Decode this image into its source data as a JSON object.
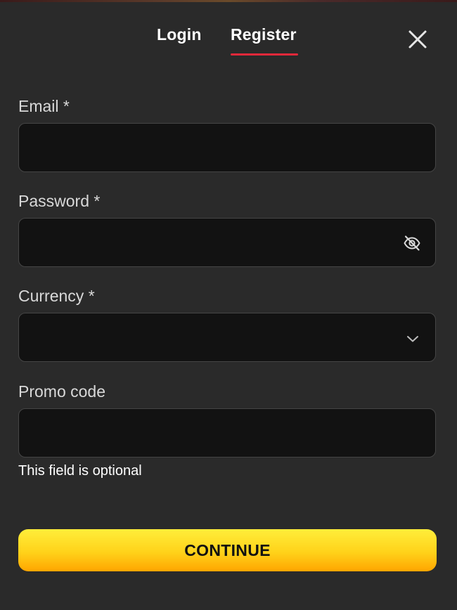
{
  "tabs": {
    "login": "Login",
    "register": "Register",
    "active": "register"
  },
  "colors": {
    "accent_underline": "#e3283a",
    "button_top": "#ffee3a",
    "button_bottom": "#ffa500",
    "background": "#2a2a2a",
    "input_bg": "#121212"
  },
  "form": {
    "email": {
      "label": "Email *",
      "value": ""
    },
    "password": {
      "label": "Password *",
      "value": "",
      "toggle_icon": "eye-off-icon"
    },
    "currency": {
      "label": "Currency *",
      "selected": "",
      "icon": "chevron-down-icon"
    },
    "promo": {
      "label": "Promo code",
      "value": "",
      "helper": "This field is optional"
    },
    "submit_label": "CONTINUE"
  },
  "icons": {
    "close": "close-icon"
  }
}
